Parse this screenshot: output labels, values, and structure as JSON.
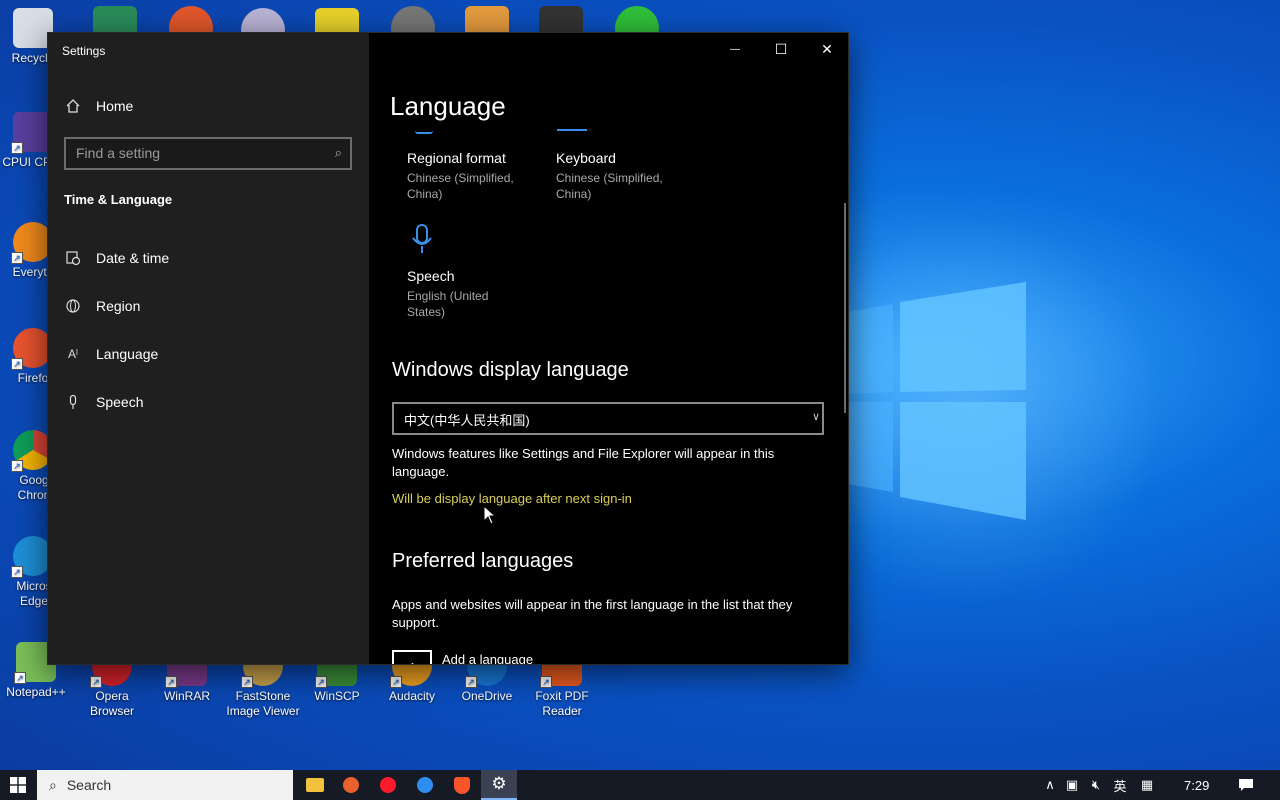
{
  "window": {
    "title": "Settings",
    "minimize_glyph": "—",
    "maximize_glyph": "☐",
    "close_glyph": "✕"
  },
  "sidebar": {
    "home_label": "Home",
    "search_placeholder": "Find a setting",
    "section_title": "Time & Language",
    "items": [
      {
        "label": "Date & time",
        "icon": "calendar-clock-icon"
      },
      {
        "label": "Region",
        "icon": "globe-icon"
      },
      {
        "label": "Language",
        "icon": "language-icon"
      },
      {
        "label": "Speech",
        "icon": "microphone-icon"
      }
    ]
  },
  "main": {
    "page_title": "Language",
    "tiles": [
      {
        "title": "Regional format",
        "sub": "Chinese (Simplified, China)"
      },
      {
        "title": "Keyboard",
        "sub": "Chinese (Simplified, China)"
      },
      {
        "title": "Speech",
        "sub": "English (United States)"
      }
    ],
    "display_language": {
      "heading": "Windows display language",
      "selected": "中文(中华人民共和国)",
      "description": "Windows features like Settings and File Explorer will appear in this language.",
      "notice": "Will be display language after next sign-in"
    },
    "preferred": {
      "heading": "Preferred languages",
      "description": "Apps and websites will appear in the first language in the list that they support.",
      "add_label": "Add a language",
      "add_glyph": "+"
    }
  },
  "desktop_icons": [
    {
      "label": "Recycle",
      "color": "#d8dde6"
    },
    {
      "label": "CPUI CPU-",
      "color": "#5a3fa0"
    },
    {
      "label": "Everyth",
      "color": "#f08a1c"
    },
    {
      "label": "Firefo",
      "color": "#e8532f"
    },
    {
      "label": "Goog Chron",
      "color": "#3ea34a"
    },
    {
      "label": "Micros Edge",
      "color": "#1e8fd6"
    },
    {
      "label": "Notepad++",
      "color": "#7bbf5a"
    },
    {
      "label": "Opera Browser",
      "color": "#d8232a"
    },
    {
      "label": "WinRAR",
      "color": "#7a3a8c"
    },
    {
      "label": "FastStone Image Viewer",
      "color": "#c9a24a"
    },
    {
      "label": "WinSCP",
      "color": "#3b8f3a"
    },
    {
      "label": "Audacity",
      "color": "#f0a020"
    },
    {
      "label": "OneDrive",
      "color": "#1778d6"
    },
    {
      "label": "Foxit PDF Reader",
      "color": "#e85a20"
    }
  ],
  "taskbar": {
    "search_label": "Search",
    "time": "7:29",
    "ime": "英",
    "accent": "#7fb6ff"
  }
}
